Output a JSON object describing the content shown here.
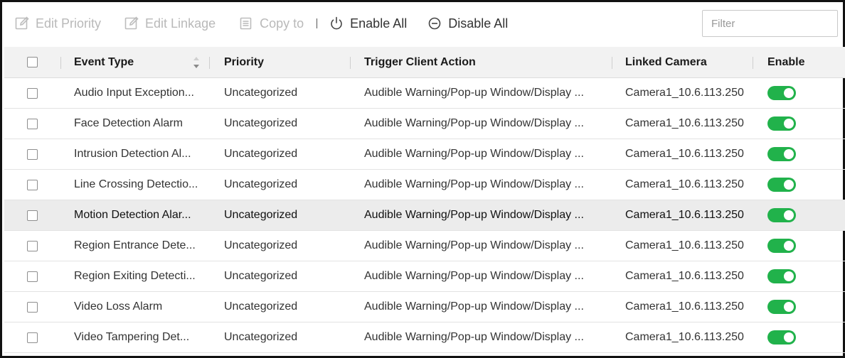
{
  "toolbar": {
    "edit_priority": "Edit Priority",
    "edit_linkage": "Edit Linkage",
    "copy_to": "Copy to",
    "enable_all": "Enable All",
    "disable_all": "Disable All",
    "filter_placeholder": "Filter"
  },
  "table": {
    "headers": {
      "event_type": "Event Type",
      "priority": "Priority",
      "trigger_client_action": "Trigger Client Action",
      "linked_camera": "Linked Camera",
      "enable": "Enable"
    },
    "rows": [
      {
        "event_type": "Audio Input Exception...",
        "priority": "Uncategorized",
        "action": "Audible Warning/Pop-up Window/Display ...",
        "camera": "Camera1_10.6.113.250",
        "enabled": true,
        "checked": false,
        "highlighted": false
      },
      {
        "event_type": "Face Detection Alarm",
        "priority": "Uncategorized",
        "action": "Audible Warning/Pop-up Window/Display ...",
        "camera": "Camera1_10.6.113.250",
        "enabled": true,
        "checked": false,
        "highlighted": false
      },
      {
        "event_type": "Intrusion Detection Al...",
        "priority": "Uncategorized",
        "action": "Audible Warning/Pop-up Window/Display ...",
        "camera": "Camera1_10.6.113.250",
        "enabled": true,
        "checked": false,
        "highlighted": false
      },
      {
        "event_type": "Line Crossing Detectio...",
        "priority": "Uncategorized",
        "action": "Audible Warning/Pop-up Window/Display ...",
        "camera": "Camera1_10.6.113.250",
        "enabled": true,
        "checked": false,
        "highlighted": false
      },
      {
        "event_type": "Motion Detection Alar...",
        "priority": "Uncategorized",
        "action": "Audible Warning/Pop-up Window/Display ...",
        "camera": "Camera1_10.6.113.250",
        "enabled": true,
        "checked": false,
        "highlighted": true
      },
      {
        "event_type": "Region Entrance Dete...",
        "priority": "Uncategorized",
        "action": "Audible Warning/Pop-up Window/Display ...",
        "camera": "Camera1_10.6.113.250",
        "enabled": true,
        "checked": false,
        "highlighted": false
      },
      {
        "event_type": "Region Exiting Detecti...",
        "priority": "Uncategorized",
        "action": "Audible Warning/Pop-up Window/Display ...",
        "camera": "Camera1_10.6.113.250",
        "enabled": true,
        "checked": false,
        "highlighted": false
      },
      {
        "event_type": "Video Loss Alarm",
        "priority": "Uncategorized",
        "action": "Audible Warning/Pop-up Window/Display ...",
        "camera": "Camera1_10.6.113.250",
        "enabled": true,
        "checked": false,
        "highlighted": false
      },
      {
        "event_type": "Video Tampering Det...",
        "priority": "Uncategorized",
        "action": "Audible Warning/Pop-up Window/Display ...",
        "camera": "Camera1_10.6.113.250",
        "enabled": true,
        "checked": false,
        "highlighted": false
      }
    ]
  },
  "colors": {
    "toggle_on": "#21b24b",
    "disabled_text": "#b9b9b9",
    "header_bg": "#f2f2f2",
    "highlight_row_bg": "#ececec"
  },
  "icons": {
    "edit_priority": "edit-icon",
    "edit_linkage": "edit-icon",
    "copy_to": "copy-icon",
    "enable_all": "power-icon",
    "disable_all": "minus-circle-icon",
    "sort": "sort-icon"
  }
}
